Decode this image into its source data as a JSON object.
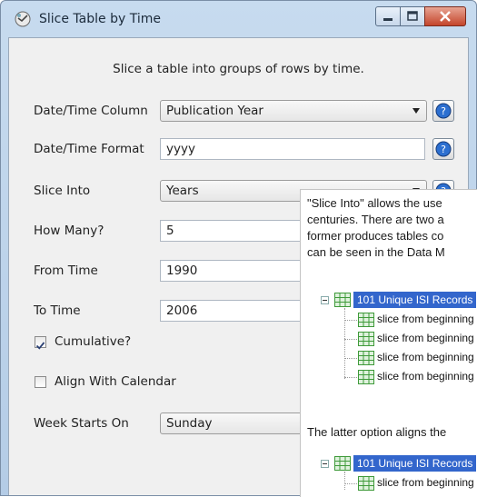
{
  "window": {
    "title": "Slice Table by Time"
  },
  "description": "Slice a table into groups of rows by time.",
  "fields": {
    "datetime_column": {
      "label": "Date/Time Column",
      "value": "Publication Year"
    },
    "datetime_format": {
      "label": "Date/Time Format",
      "value": "yyyy"
    },
    "slice_into": {
      "label": "Slice Into",
      "value": "Years"
    },
    "how_many": {
      "label": "How Many?",
      "value": "5"
    },
    "from_time": {
      "label": "From Time",
      "value": "1990"
    },
    "to_time": {
      "label": "To Time",
      "value": "2006"
    },
    "cumulative": {
      "label": "Cumulative?",
      "checked": true
    },
    "align_calendar": {
      "label": "Align With Calendar",
      "checked": false
    },
    "week_starts_on": {
      "label": "Week Starts On",
      "value": "Sunday"
    }
  },
  "help_popup": {
    "lines": [
      "\"Slice Into\" allows the use",
      "centuries. There are two a",
      "former produces tables co",
      "can be seen in the Data M"
    ],
    "tree1": {
      "root": "101 Unique ISI Records",
      "children": [
        "slice from beginning",
        "slice from beginning",
        "slice from beginning",
        "slice from beginning"
      ]
    },
    "latter_text": "The latter option aligns the",
    "tree2": {
      "root": "101 Unique ISI Records",
      "children": [
        "slice from beginning"
      ]
    }
  },
  "colors": {
    "selection": "#3366cc",
    "client_bg": "#f0f0f0",
    "title_gradient": "#c7dbef"
  },
  "icons": [
    "app-icon",
    "minimize-icon",
    "maximize-icon",
    "close-icon",
    "help-icon",
    "table-icon"
  ]
}
